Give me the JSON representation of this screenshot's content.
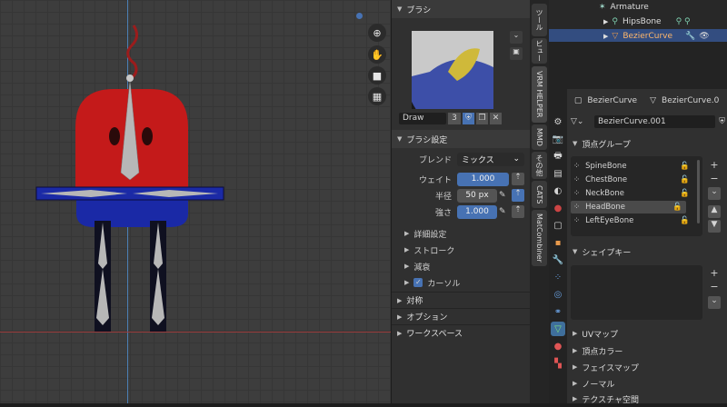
{
  "brush_panel": {
    "header": "ブラシ",
    "brush_name": "Draw",
    "brush_users": "3",
    "settings_header": "ブラシ設定",
    "blend_label": "ブレンド",
    "blend_value": "ミックス",
    "weight_label": "ウェイト",
    "weight_value": "1.000",
    "radius_label": "半径",
    "radius_value": "50 px",
    "strength_label": "強さ",
    "strength_value": "1.000",
    "subsections": [
      "詳細設定",
      "ストローク",
      "減衰",
      "カーソル"
    ],
    "sections": [
      "対称",
      "オプション",
      "ワークスペース"
    ]
  },
  "sidebar_tabs": [
    "ツール",
    "ビュー",
    "VRM HELPER",
    "MMD",
    "その他",
    "CATS",
    "MatCombiner"
  ],
  "outliner": {
    "rows": [
      {
        "label": "Armature"
      },
      {
        "label": "HipsBone"
      },
      {
        "label": "BezierCurve"
      }
    ]
  },
  "properties": {
    "object_name": "BezierCurve",
    "data_name": "BezierCurve.0",
    "mesh_name": "BezierCurve.001",
    "vertex_groups_header": "頂点グループ",
    "vertex_groups": [
      "SpineBone",
      "ChestBone",
      "NeckBone",
      "HeadBone",
      "LeftEyeBone"
    ],
    "active_group": "HeadBone",
    "shape_keys_header": "シェイプキー",
    "sections": [
      "UVマップ",
      "頂点カラー",
      "フェイスマップ",
      "ノーマル",
      "テクスチャ空間"
    ]
  },
  "colors": {
    "accent": "#4772b3",
    "head_red": "#c21b1b",
    "body_blue": "#1b2aa6"
  }
}
